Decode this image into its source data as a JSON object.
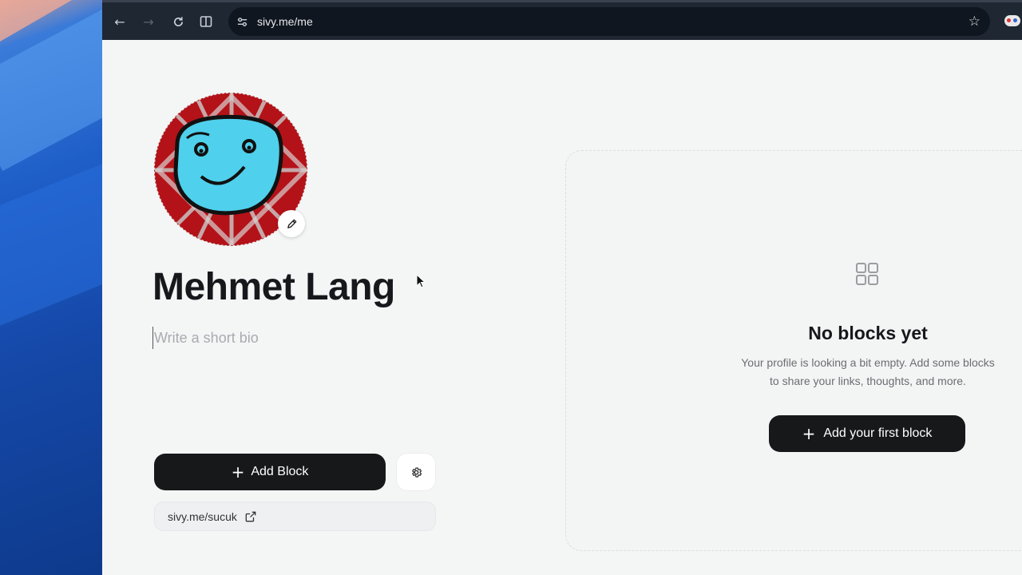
{
  "browser": {
    "url": "sivy.me/me",
    "icons": [
      "back-icon",
      "forward-icon",
      "reload-icon",
      "split-view-icon",
      "site-settings-icon",
      "bookmark-star-icon",
      "extension-icon"
    ]
  },
  "profile": {
    "name": "Mehmet Lang",
    "bio_placeholder": "Write a short bio",
    "bio_value": "",
    "link": "sivy.me/sucuk"
  },
  "actions": {
    "add_block_label": "Add Block"
  },
  "empty_state": {
    "title": "No blocks yet",
    "description": "Your profile is looking a bit empty. Add some blocks to share your links, thoughts, and more.",
    "button_label": "Add your first block"
  },
  "colors": {
    "page_background": "#f4f5f5",
    "primary_button": "#17181a",
    "browser_bar": "#1f2733",
    "avatar_red": "#b31218",
    "avatar_face": "#4fd0ec"
  }
}
